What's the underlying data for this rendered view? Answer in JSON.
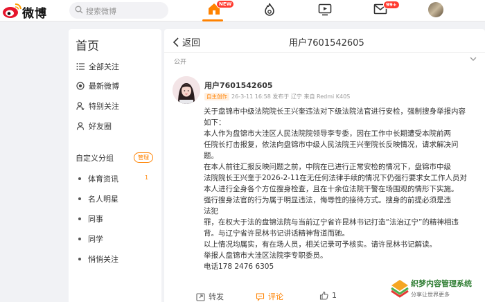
{
  "header": {
    "logo_text": "微博",
    "search_placeholder": "搜索微博",
    "home_badge": "NEW",
    "msg_badge": "99+",
    "accent": "#ff8200"
  },
  "sidebar": {
    "title": "首页",
    "items": [
      {
        "label": "全部关注",
        "icon": "list-icon"
      },
      {
        "label": "最新微博",
        "icon": "target-icon"
      },
      {
        "label": "特别关注",
        "icon": "user-star-icon"
      },
      {
        "label": "好友圈",
        "icon": "user-icon"
      }
    ],
    "section_title": "自定义分组",
    "manage_label": "管理",
    "groups": [
      {
        "label": "体育资讯",
        "count": "1"
      },
      {
        "label": "名人明星",
        "count": ""
      },
      {
        "label": "同事",
        "count": ""
      },
      {
        "label": "同学",
        "count": ""
      },
      {
        "label": "悄悄关注",
        "count": ""
      }
    ]
  },
  "main": {
    "back_label": "返回",
    "page_user": "用户7601542605",
    "visibility": "公开",
    "post": {
      "author": "用户7601542605",
      "tag": "自主创作",
      "meta": "26-3-11 16:58 发布于 辽宁 来自 Redmi K40S",
      "lines": [
        "关于盘锦市中级法院院长王兴奎违法对下级法院法官进行安检，强制搜身举报内容",
        "如下：",
        "    本人作为盘锦市大洼区人民法院院领导李专委，因在工作中长期遭受本院前两",
        "任院长打击报复，依法向盘锦市中级人民法院王兴奎院长反映情况，请求解决问",
        "题。",
        "    在本人前往汇报反映问题之前，中院在已进行正常安检的情况下，盘锦市中级",
        "法院院长王兴奎于2026-2-11在无任何法律手续的情况下仍强行要求女工作人员对",
        "本人进行全身各个方位搜身检查，且在十余位法院干警在场围观的情形下实施。",
        "    强行搜身法官的行为属于明显违法，侮辱性的接待方式。搜身的前提必须是违",
        "法犯",
        "罪，在权大于法的盘锦法院与当前辽宁省许昆林书记打造“法治辽宁”的精神相违",
        "背。与辽宁省许昆林书记讲话精神背道而驰。",
        "    以上情况均属实，有在场人员，相关记录可予核实。请许昆林书记解读。",
        "    举报人盘锦市大洼区法院李专职委员。",
        "    电话178 2476 6305"
      ]
    },
    "actions": {
      "repost": "转发",
      "comment": "评论",
      "like": "1"
    }
  },
  "watermark": {
    "title": "织梦内容管理系统",
    "subtitle": "分享让世界更多"
  }
}
